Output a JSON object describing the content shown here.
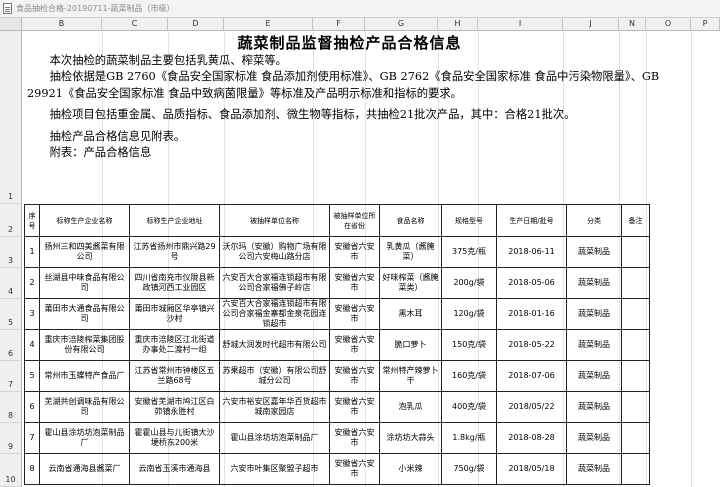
{
  "window": {
    "title": "食品抽检合格-20190711-蔬菜制品（市级）"
  },
  "columns": [
    "B",
    "C",
    "D",
    "E",
    "F",
    "G",
    "H",
    "I",
    "J",
    "N",
    "O",
    "P"
  ],
  "rows": [
    "1",
    "2",
    "3",
    "4",
    "5",
    "6",
    "7",
    "8",
    "9",
    "10"
  ],
  "notice": {
    "title": "蔬菜制品监督抽检产品合格信息",
    "paragraphs": [
      "本次抽检的蔬菜制品主要包括乳黄瓜、榨菜等。",
      "抽检依据是GB 2760《食品安全国家标准 食品添加剂使用标准》、GB 2762《食品安全国家标准 食品中污染物限量》、GB 29921《食品安全国家标准 食品中致病菌限量》等标准及产品明示标准和指标的要求。",
      "抽检项目包括重金属、品质指标、食品添加剂、微生物等指标，共抽检21批次产品，其中：合格21批次。",
      "抽检产品合格信息见附表。",
      "附表：产品合格信息"
    ]
  },
  "table": {
    "headers": [
      "序号",
      "标称生产企业名称",
      "标称生产企业地址",
      "被抽样单位名称",
      "被抽样单位所在省份",
      "食品名称",
      "规格型号",
      "生产日期/批号",
      "分类",
      "备注"
    ],
    "rows": [
      [
        "1",
        "扬州三和四美酱菜有限公司",
        "江苏省扬州市鼎兴路29号",
        "沃尔玛（安徽）购物广场有限公司六安梅山路分店",
        "安徽省六安市",
        "乳黄瓜（酱腌菜）",
        "375克/瓶",
        "2018-06-11",
        "蔬菜制品",
        ""
      ],
      [
        "2",
        "丝湖县中味食品有限公司",
        "四川省南充市仪陇县新政镇河西工业园区",
        "六安百大合家福连锁超市有限公司合家福佛子岭店",
        "安徽省六安市",
        "好味榨菜（酱腌菜类）",
        "200g/袋",
        "2018-05-06",
        "蔬菜制品",
        ""
      ],
      [
        "3",
        "莆田市大通食品有限公司",
        "莆田市城厢区华亭镇兴沙村",
        "六安百大合家福连锁超市有限公司合家福金寨都金泉花园连锁超市",
        "安徽省六安市",
        "黑木耳",
        "120g/袋",
        "2018-01-16",
        "蔬菜制品",
        ""
      ],
      [
        "4",
        "重庆市涪陵榨菜集团股份有限公司",
        "重庆市涪陵区江北街道办事处二渡村一组",
        "舒城大润发时代超市有限公司",
        "安徽省六安市",
        "脆口萝卜",
        "150克/袋",
        "2018-05-22",
        "蔬菜制品",
        ""
      ],
      [
        "5",
        "常州市玉蝶特产食品厂",
        "江苏省常州市钟楼区五兰路68号",
        "苏果超市（安徽）有限公司舒城分公司",
        "安徽省六安市",
        "常州特产辣萝卜干",
        "160克/袋",
        "2018-07-06",
        "蔬菜制品",
        ""
      ],
      [
        "6",
        "芜湖共创调味品有限公司",
        "安徽省芜湖市鸠江区白茆镇永胜村",
        "六安市裕安区嘉年华百货超市城南家园店",
        "安徽省六安市",
        "泡乳瓜",
        "400克/袋",
        "2018/05/22",
        "蔬菜制品",
        ""
      ],
      [
        "7",
        "霍山县涂坊坊泡菜制品厂",
        "霍霍山县与儿街镇大沙埂桥东200米",
        "霍山县涂坊坊泡菜制品厂",
        "安徽省六安市",
        "涂坊坊大蒜头",
        "1.8kg/瓶",
        "2018-08-28",
        "蔬菜制品",
        ""
      ],
      [
        "8",
        "云南省通海县酱菜厂",
        "云南省玉溪市通海县",
        "六安市叶集区聚盟子超市",
        "安徽省六安市",
        "小米辣",
        "750g/袋",
        "2018/05/18",
        "蔬菜制品",
        ""
      ]
    ]
  }
}
